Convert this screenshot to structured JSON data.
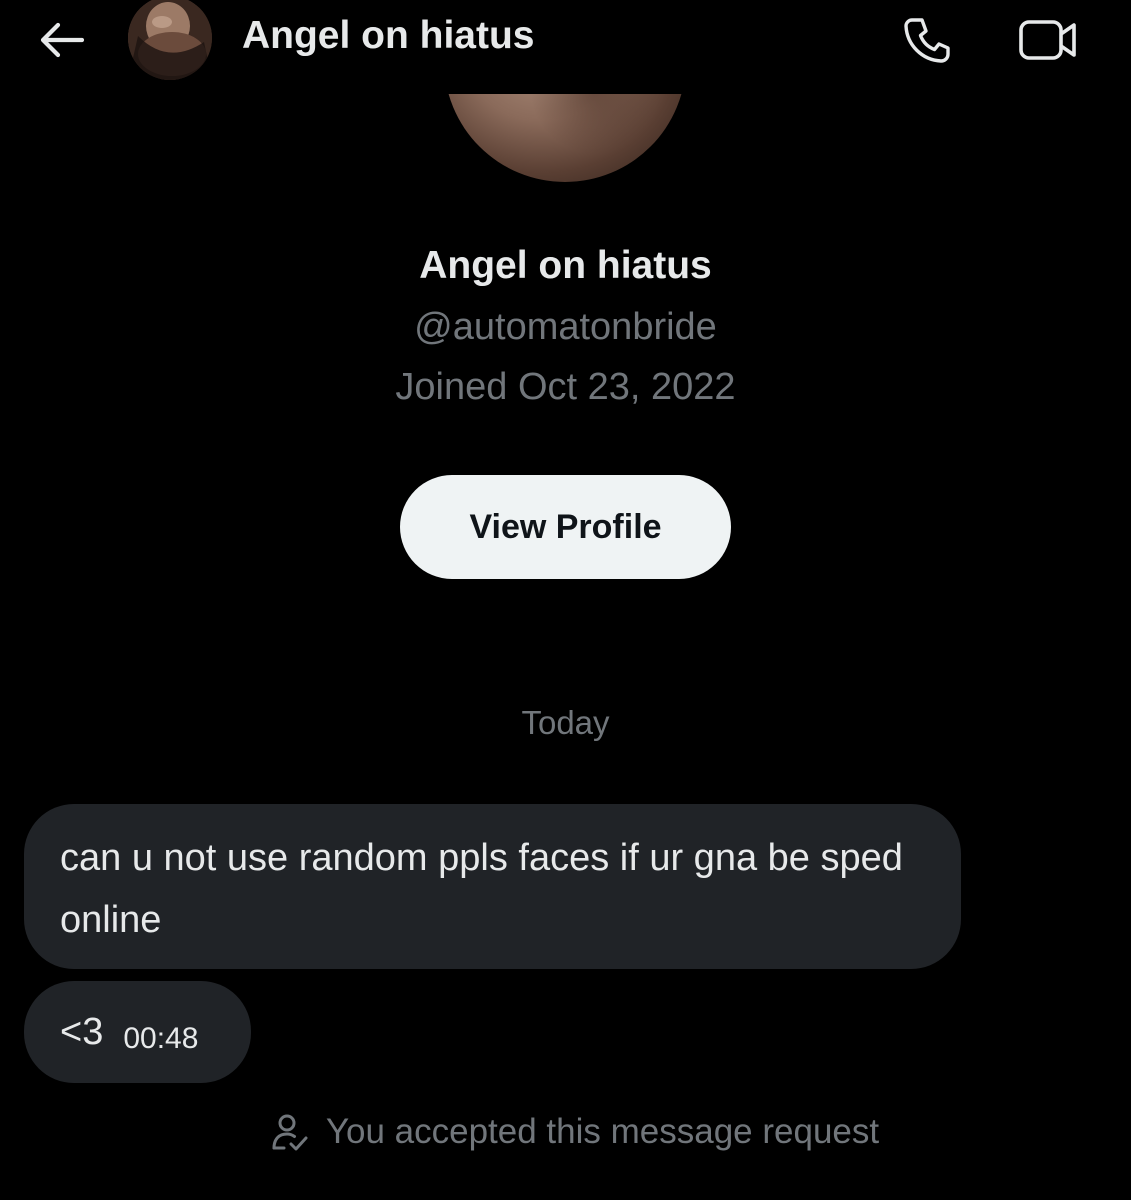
{
  "header": {
    "title": "Angel on hiatus",
    "back_icon": "arrow-left-icon",
    "call_icon": "phone-icon",
    "video_icon": "video-camera-icon"
  },
  "profile": {
    "name": "Angel on hiatus",
    "handle": "@automatonbride",
    "joined": "Joined Oct 23, 2022",
    "view_profile_label": "View Profile"
  },
  "conversation": {
    "date_divider": "Today",
    "messages": [
      {
        "text": "can u not use random ppls faces if ur gna be sped online",
        "time": ""
      },
      {
        "text": "<3",
        "time": "00:48"
      }
    ],
    "request_note": "You accepted this message request",
    "request_icon": "person-check-icon"
  },
  "colors": {
    "background": "#000000",
    "primary_text": "#e7e9ea",
    "secondary_text": "#71767b",
    "bubble": "#202327",
    "button_bg": "#eff3f4",
    "button_text": "#0f1419"
  }
}
